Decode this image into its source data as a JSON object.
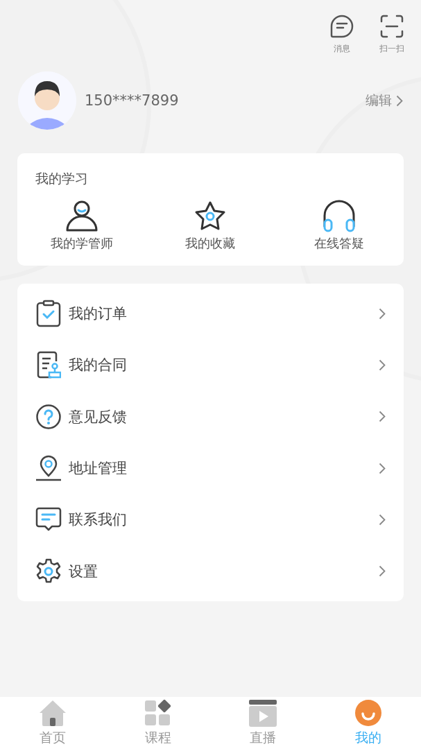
{
  "header_actions": [
    {
      "kind": "message",
      "label": "消息"
    },
    {
      "kind": "scan",
      "label": "扫一扫"
    }
  ],
  "profile": {
    "phone": "150****7899",
    "edit": "编辑"
  },
  "study": {
    "title": "我的学习",
    "items": [
      {
        "kind": "advisor",
        "label": "我的学管师"
      },
      {
        "kind": "favorite",
        "label": "我的收藏"
      },
      {
        "kind": "support",
        "label": "在线答疑"
      }
    ]
  },
  "menu": [
    {
      "kind": "order",
      "label": "我的订单"
    },
    {
      "kind": "contract",
      "label": "我的合同"
    },
    {
      "kind": "feedback",
      "label": "意见反馈"
    },
    {
      "kind": "address",
      "label": "地址管理"
    },
    {
      "kind": "contact",
      "label": "联系我们"
    },
    {
      "kind": "settings",
      "label": "设置"
    }
  ],
  "tabs": [
    {
      "kind": "home",
      "label": "首页",
      "selected": false
    },
    {
      "kind": "courses",
      "label": "课程",
      "selected": false
    },
    {
      "kind": "live",
      "label": "直播",
      "selected": false
    },
    {
      "kind": "mine",
      "label": "我的",
      "selected": true
    }
  ]
}
